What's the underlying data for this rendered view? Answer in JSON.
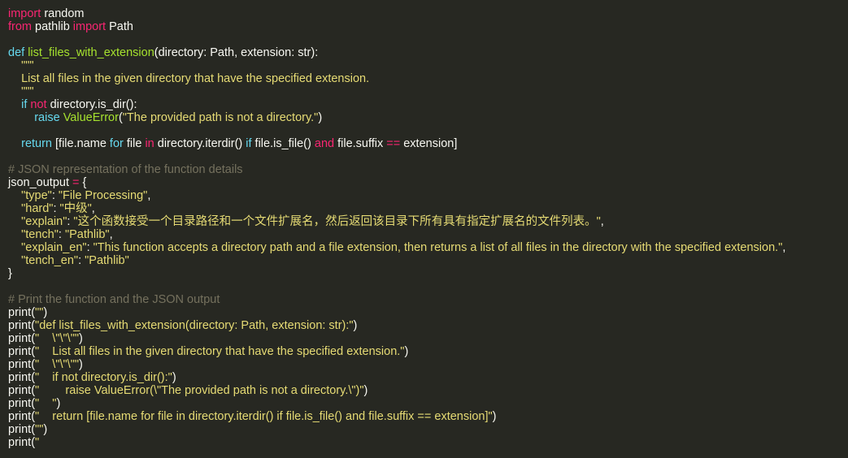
{
  "colors": {
    "background": "#272822",
    "keyword": "#f92672",
    "function": "#a6e22e",
    "string": "#e6db74",
    "comment": "#75715e",
    "builtin": "#66d9ef",
    "plain": "#f8f8f2"
  },
  "lines": [
    {
      "tokens": [
        {
          "c": "kw",
          "t": "import"
        },
        {
          "c": "pl",
          "t": " random"
        }
      ]
    },
    {
      "tokens": [
        {
          "c": "kw",
          "t": "from"
        },
        {
          "c": "pl",
          "t": " pathlib "
        },
        {
          "c": "kw",
          "t": "import"
        },
        {
          "c": "pl",
          "t": " Path"
        }
      ]
    },
    {
      "tokens": []
    },
    {
      "tokens": [
        {
          "c": "bi",
          "t": "def"
        },
        {
          "c": "pl",
          "t": " "
        },
        {
          "c": "fn",
          "t": "list_files_with_extension"
        },
        {
          "c": "pl",
          "t": "(directory: Path, extension: str):"
        }
      ]
    },
    {
      "tokens": [
        {
          "c": "str",
          "t": "    \"\"\""
        }
      ]
    },
    {
      "tokens": [
        {
          "c": "str",
          "t": "    List all files in the given directory that have the specified extension."
        }
      ]
    },
    {
      "tokens": [
        {
          "c": "str",
          "t": "    \"\"\""
        }
      ]
    },
    {
      "tokens": [
        {
          "c": "bi",
          "t": "    if"
        },
        {
          "c": "pl",
          "t": " "
        },
        {
          "c": "kw",
          "t": "not"
        },
        {
          "c": "pl",
          "t": " directory.is_dir():"
        }
      ]
    },
    {
      "tokens": [
        {
          "c": "bi",
          "t": "        raise"
        },
        {
          "c": "pl",
          "t": " "
        },
        {
          "c": "fn",
          "t": "ValueError"
        },
        {
          "c": "pl",
          "t": "("
        },
        {
          "c": "str",
          "t": "\"The provided path is not a directory.\""
        },
        {
          "c": "pl",
          "t": ")"
        }
      ]
    },
    {
      "tokens": []
    },
    {
      "tokens": [
        {
          "c": "bi",
          "t": "    return"
        },
        {
          "c": "pl",
          "t": " [file.name "
        },
        {
          "c": "bi",
          "t": "for"
        },
        {
          "c": "pl",
          "t": " file "
        },
        {
          "c": "kw",
          "t": "in"
        },
        {
          "c": "pl",
          "t": " directory.iterdir() "
        },
        {
          "c": "bi",
          "t": "if"
        },
        {
          "c": "pl",
          "t": " file.is_file() "
        },
        {
          "c": "kw",
          "t": "and"
        },
        {
          "c": "pl",
          "t": " file.suffix "
        },
        {
          "c": "op",
          "t": "=="
        },
        {
          "c": "pl",
          "t": " extension]"
        }
      ]
    },
    {
      "tokens": []
    },
    {
      "tokens": [
        {
          "c": "cmt",
          "t": "# JSON representation of the function details"
        }
      ]
    },
    {
      "tokens": [
        {
          "c": "pl",
          "t": "json_output "
        },
        {
          "c": "op",
          "t": "="
        },
        {
          "c": "pl",
          "t": " {"
        }
      ]
    },
    {
      "tokens": [
        {
          "c": "str",
          "t": "    \"type\""
        },
        {
          "c": "pl",
          "t": ": "
        },
        {
          "c": "str",
          "t": "\"File Processing\""
        },
        {
          "c": "pl",
          "t": ","
        }
      ]
    },
    {
      "tokens": [
        {
          "c": "str",
          "t": "    \"hard\""
        },
        {
          "c": "pl",
          "t": ": "
        },
        {
          "c": "str",
          "t": "\"中级\""
        },
        {
          "c": "pl",
          "t": ","
        }
      ]
    },
    {
      "tokens": [
        {
          "c": "str",
          "t": "    \"explain\""
        },
        {
          "c": "pl",
          "t": ": "
        },
        {
          "c": "str",
          "t": "\"这个函数接受一个目录路径和一个文件扩展名，然后返回该目录下所有具有指定扩展名的文件列表。\""
        },
        {
          "c": "pl",
          "t": ","
        }
      ]
    },
    {
      "tokens": [
        {
          "c": "str",
          "t": "    \"tench\""
        },
        {
          "c": "pl",
          "t": ": "
        },
        {
          "c": "str",
          "t": "\"Pathlib\""
        },
        {
          "c": "pl",
          "t": ","
        }
      ]
    },
    {
      "tokens": [
        {
          "c": "str",
          "t": "    \"explain_en\""
        },
        {
          "c": "pl",
          "t": ": "
        },
        {
          "c": "str",
          "t": "\"This function accepts a directory path and a file extension, then returns a list of all files in the directory with the specified extension.\""
        },
        {
          "c": "pl",
          "t": ","
        }
      ]
    },
    {
      "tokens": [
        {
          "c": "str",
          "t": "    \"tench_en\""
        },
        {
          "c": "pl",
          "t": ": "
        },
        {
          "c": "str",
          "t": "\"Pathlib\""
        }
      ]
    },
    {
      "tokens": [
        {
          "c": "pl",
          "t": "}"
        }
      ]
    },
    {
      "tokens": []
    },
    {
      "tokens": [
        {
          "c": "cmt",
          "t": "# Print the function and the JSON output"
        }
      ]
    },
    {
      "tokens": [
        {
          "c": "pl",
          "t": "print("
        },
        {
          "c": "str",
          "t": "\"\""
        },
        {
          "c": "pl",
          "t": ")"
        }
      ]
    },
    {
      "tokens": [
        {
          "c": "pl",
          "t": "print("
        },
        {
          "c": "str",
          "t": "\"def list_files_with_extension(directory: Path, extension: str):\""
        },
        {
          "c": "pl",
          "t": ")"
        }
      ]
    },
    {
      "tokens": [
        {
          "c": "pl",
          "t": "print("
        },
        {
          "c": "str",
          "t": "\"    \\\"\\\"\\\"\""
        },
        {
          "c": "pl",
          "t": ")"
        }
      ]
    },
    {
      "tokens": [
        {
          "c": "pl",
          "t": "print("
        },
        {
          "c": "str",
          "t": "\"    List all files in the given directory that have the specified extension.\""
        },
        {
          "c": "pl",
          "t": ")"
        }
      ]
    },
    {
      "tokens": [
        {
          "c": "pl",
          "t": "print("
        },
        {
          "c": "str",
          "t": "\"    \\\"\\\"\\\"\""
        },
        {
          "c": "pl",
          "t": ")"
        }
      ]
    },
    {
      "tokens": [
        {
          "c": "pl",
          "t": "print("
        },
        {
          "c": "str",
          "t": "\"    if not directory.is_dir():\""
        },
        {
          "c": "pl",
          "t": ")"
        }
      ]
    },
    {
      "tokens": [
        {
          "c": "pl",
          "t": "print("
        },
        {
          "c": "str",
          "t": "\"        raise ValueError(\\\"The provided path is not a directory.\\\")\""
        },
        {
          "c": "pl",
          "t": ")"
        }
      ]
    },
    {
      "tokens": [
        {
          "c": "pl",
          "t": "print("
        },
        {
          "c": "str",
          "t": "\"    \""
        },
        {
          "c": "pl",
          "t": ")"
        }
      ]
    },
    {
      "tokens": [
        {
          "c": "pl",
          "t": "print("
        },
        {
          "c": "str",
          "t": "\"    return [file.name for file in directory.iterdir() if file.is_file() and file.suffix == extension]\""
        },
        {
          "c": "pl",
          "t": ")"
        }
      ]
    },
    {
      "tokens": [
        {
          "c": "pl",
          "t": "print("
        },
        {
          "c": "str",
          "t": "\"\""
        },
        {
          "c": "pl",
          "t": ")"
        }
      ]
    },
    {
      "tokens": [
        {
          "c": "pl",
          "t": "print("
        },
        {
          "c": "str",
          "t": "\""
        }
      ]
    }
  ]
}
